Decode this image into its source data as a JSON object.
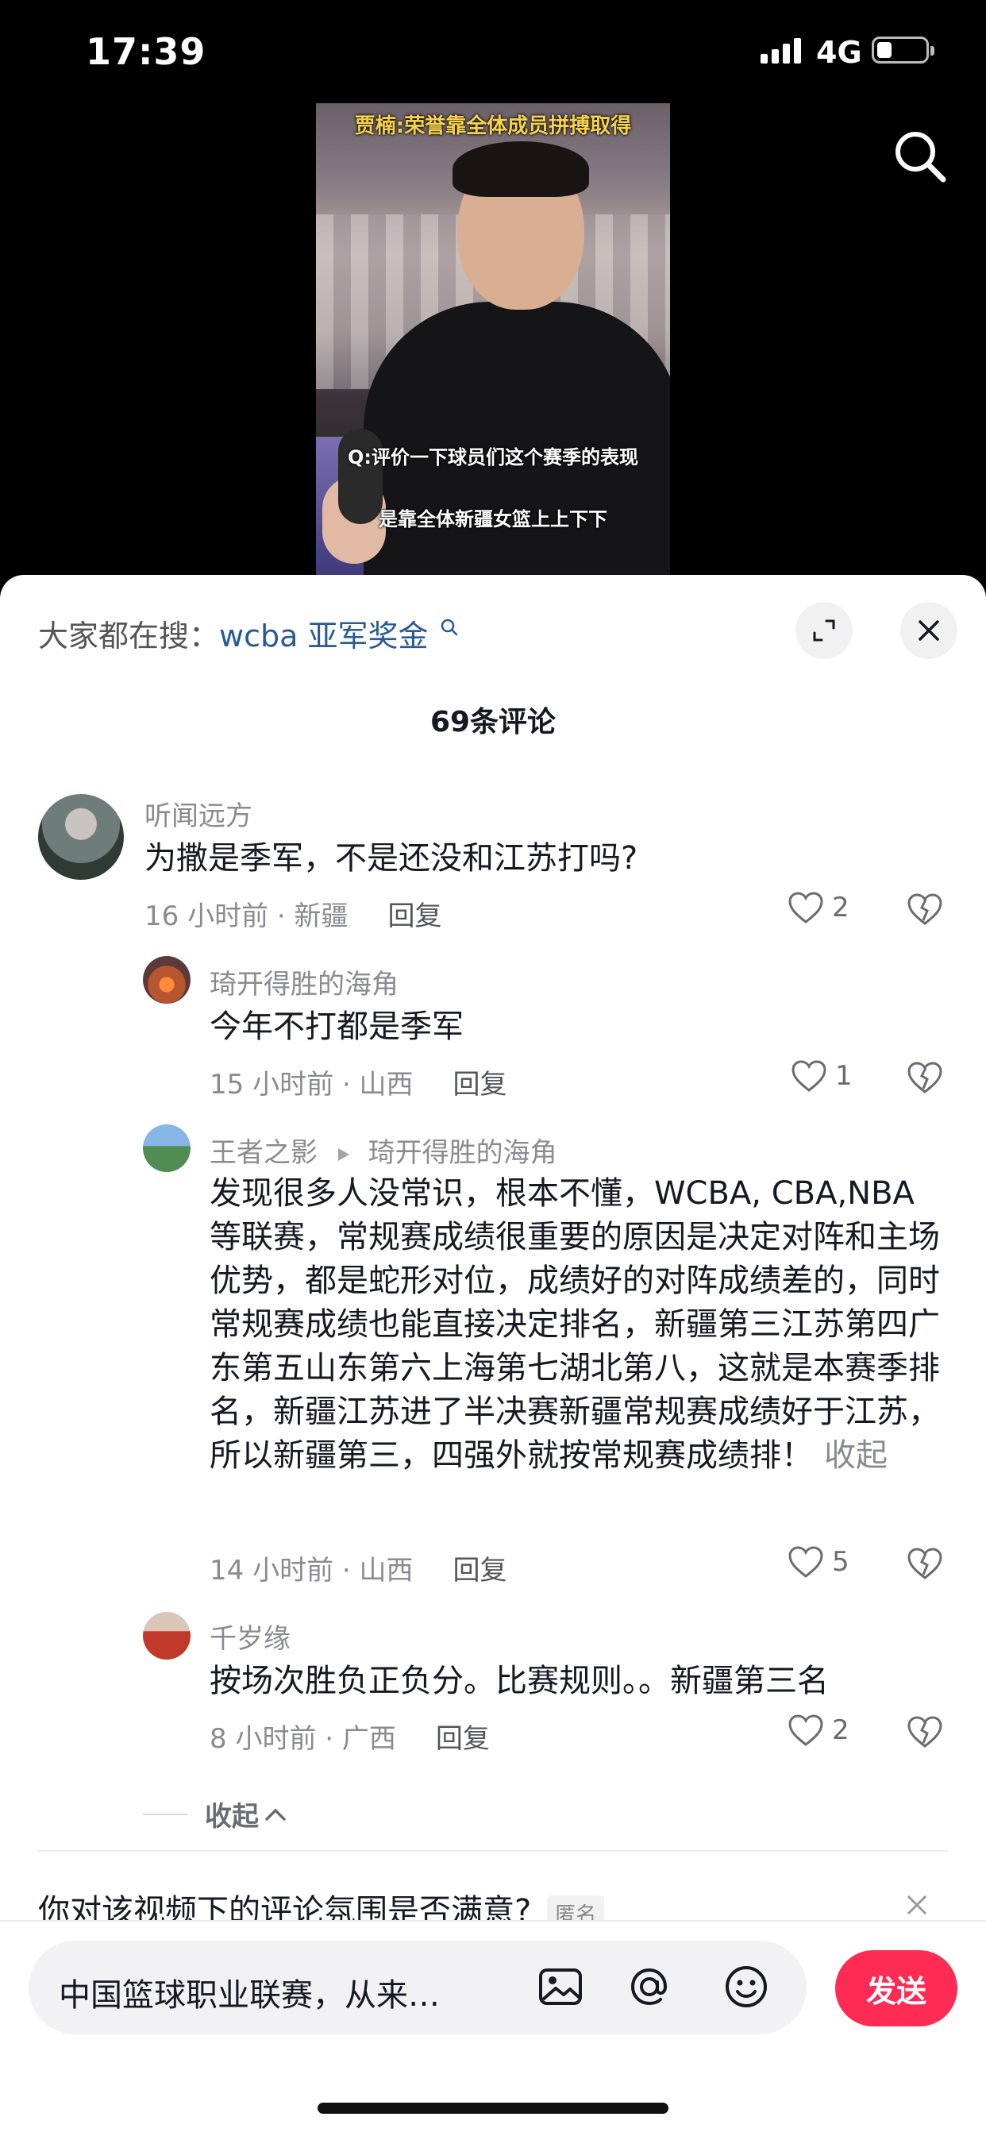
{
  "status_bar": {
    "time": "17:39",
    "network": "4G"
  },
  "video": {
    "caption_top": "贾楠:荣誉靠全体成员拼搏取得",
    "caption_question": "Q:评价一下球员们这个赛季的表现",
    "caption_answer": "是靠全体新疆女篮上上下下"
  },
  "panel": {
    "suggest_prefix": "大家都在搜：",
    "suggest_keyword": "wcba 亚军奖金",
    "comment_count": "69条评论",
    "comments": [
      {
        "name": "听闻远方",
        "text": "为撒是季军，不是还没和江苏打吗?",
        "meta": "16 小时前 · 新疆",
        "reply": "回复",
        "likes": "2"
      },
      {
        "name": "琦开得胜的海角",
        "text": "今年不打都是季军",
        "meta": "15 小时前 · 山西",
        "reply": "回复",
        "likes": "1"
      },
      {
        "name": "王者之影",
        "reply_to": "琦开得胜的海角",
        "text": "发现很多人没常识，根本不懂，WCBA, CBA,NBA 等联赛，常规赛成绩很重要的原因是决定对阵和主场优势，都是蛇形对位，成绩好的对阵成绩差的，同时常规赛成绩也能直接决定排名，新疆第三江苏第四广东第五山东第六上海第七湖北第八，这就是本赛季排名，新疆江苏进了半决赛新疆常规赛成绩好于江苏，所以新疆第三，四强外就按常规赛成绩排！",
        "collapse": "收起",
        "meta": "14 小时前 · 山西",
        "reply": "回复",
        "likes": "5"
      },
      {
        "name": "千岁缘",
        "text": "按场次胜负正负分。比赛规则。。新疆第三名",
        "meta": "8 小时前 · 广西",
        "reply": "回复",
        "likes": "2"
      }
    ],
    "collapse_replies": "收起",
    "survey_question": "你对该视频下的评论氛围是否满意?",
    "survey_tag": "匿名"
  },
  "input_bar": {
    "placeholder": "中国篮球职业联赛，从来…",
    "send_label": "发送"
  },
  "colors": {
    "accent": "#fe2c55",
    "link": "#2a5a92"
  }
}
